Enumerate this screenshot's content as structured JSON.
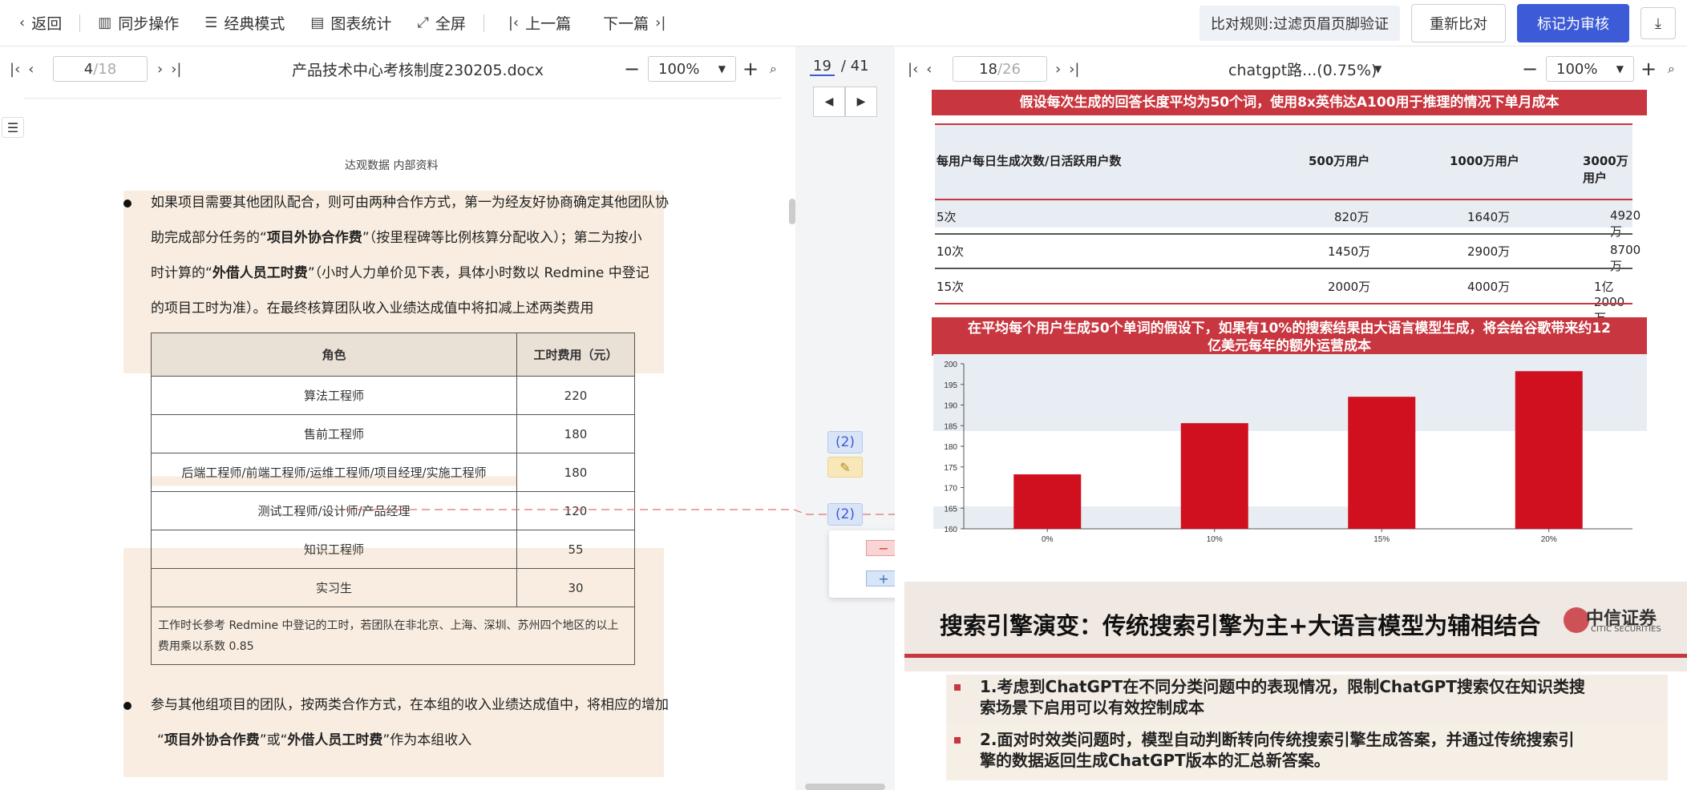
{
  "toolbar": {
    "back": "返回",
    "sync": "同步操作",
    "classic": "经典模式",
    "stats": "图表统计",
    "fullscreen": "全屏",
    "prev": "上一篇",
    "next": "下一篇",
    "rule": "比对规则:过滤页眉页脚验证",
    "recompare": "重新比对",
    "mark_reviewed": "标记为审核"
  },
  "left": {
    "page": "4",
    "total": "/18",
    "title": "产品技术中心考核制度230205.docx",
    "zoom": "100%",
    "doc_header": "达观数据 内部资料",
    "para1": [
      "如果项目需要其他团队配合，则可由两种合作方式，第一为经友好协商确定其他团队协",
      "助完成部分任务的“",
      "项目外协合作费",
      "”（按里程碑等比例核算分配收入）；第二为按小",
      "时计算的“",
      "外借人员工时费",
      "”（小时人力单价见下表，具体小时数以 Redmine 中登记",
      "的项目工时为准）。在最终核算团队收入业绩达成值中将扣减上述两类费用"
    ],
    "table": {
      "headers": [
        "角色",
        "工时费用（元）"
      ],
      "rows": [
        [
          "算法工程师",
          "220"
        ],
        [
          "售前工程师",
          "180"
        ],
        [
          "后端工程师/前端工程师/运维工程师/项目经理/实施工程师",
          "180"
        ],
        [
          "测试工程师/设计师/产品经理",
          "120"
        ],
        [
          "知识工程师",
          "55"
        ],
        [
          "实习生",
          "30"
        ]
      ],
      "note": "工作时长参考 Redmine 中登记的工时，若团队在非北京、上海、深圳、苏州四个地区的以上费用乘以系数 0.85"
    },
    "para2": [
      "参与其他组项目的团队，按两类合作方式，在本组的收入业绩达成值中，将相应的增加",
      "“",
      "项目外协合作费",
      "”或“",
      "外借人员工时费",
      "”作为本组收入"
    ]
  },
  "middle": {
    "current": "19",
    "total": "/ 41",
    "badge1": "(2)",
    "badge2": "(2)"
  },
  "right": {
    "page": "18",
    "total": "/26",
    "title": "chatgpt路...(0.75%)",
    "zoom": "100%",
    "banner1": "假设每次生成的回答长度平均为50个词，使用8x英伟达A100用于推理的情况下单月成本",
    "cost_headers": [
      "每用户每日生成次数/日活跃用户数",
      "500万用户",
      "1000万用户",
      "3000万用户"
    ],
    "cost_rows": [
      [
        "5次",
        "820万",
        "1640万",
        "4920万"
      ],
      [
        "10次",
        "1450万",
        "2900万",
        "8700万"
      ],
      [
        "15次",
        "2000万",
        "4000万",
        "1亿2000万"
      ]
    ],
    "banner2_line1": "在平均每个用户生成50个单词的假设下，如果有10%的搜索结果由大语言模型生成，将会给谷歌带来约12",
    "banner2_line2": "亿美元每年的额外运营成本",
    "slide_title": "搜索引擎演变：传统搜索引擎为主+大语言模型为辅相结合",
    "logo_text": "中信证券",
    "logo_sub": "CITIC SECURITIES",
    "point1_line1": "1.考虑到ChatGPT在不同分类问题中的表现情况，限制ChatGPT搜索仅在知识类搜",
    "point1_line2": "索场景下启用可以有效控制成本",
    "point2_line1": "2.面对时效类问题时，模型自动判断转向传统搜索引擎生成答案，并通过传统搜索引",
    "point2_line2": "擎的数据返回生成ChatGPT版本的汇总新答案。"
  },
  "chart_data": {
    "type": "bar",
    "categories": [
      "0%",
      "10%",
      "15%",
      "20%"
    ],
    "values": [
      173.2,
      185.6,
      192,
      198.2
    ],
    "ylim": [
      160,
      200
    ],
    "yticks": [
      160,
      165,
      170,
      175,
      180,
      185,
      190,
      195,
      200
    ],
    "color": "#d0101e"
  }
}
